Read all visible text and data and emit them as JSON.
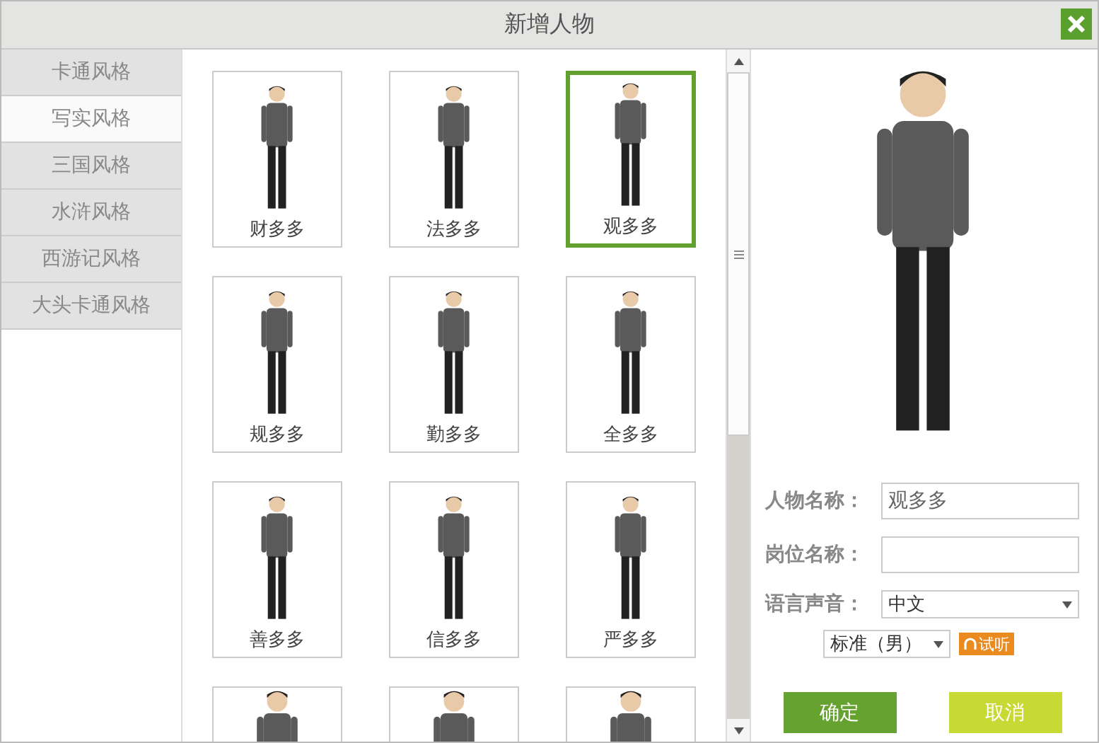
{
  "window": {
    "title": "新增人物"
  },
  "sidebar": {
    "items": [
      {
        "label": "卡通风格",
        "selected": false
      },
      {
        "label": "写实风格",
        "selected": true
      },
      {
        "label": "三国风格",
        "selected": false
      },
      {
        "label": "水浒风格",
        "selected": false
      },
      {
        "label": "西游记风格",
        "selected": false
      },
      {
        "label": "大头卡通风格",
        "selected": false
      }
    ]
  },
  "characters": [
    {
      "name": "财多多",
      "selected": false
    },
    {
      "name": "法多多",
      "selected": false
    },
    {
      "name": "观多多",
      "selected": true
    },
    {
      "name": "规多多",
      "selected": false
    },
    {
      "name": "勤多多",
      "selected": false
    },
    {
      "name": "全多多",
      "selected": false
    },
    {
      "name": "善多多",
      "selected": false
    },
    {
      "name": "信多多",
      "selected": false
    },
    {
      "name": "严多多",
      "selected": false
    },
    {
      "selected": false
    },
    {
      "selected": false
    },
    {
      "selected": false
    }
  ],
  "form": {
    "name_label": "人物名称：",
    "name_value": "观多多",
    "post_label": "岗位名称：",
    "voice_label": "语言声音：",
    "language": "中文",
    "voice": "标准（男）",
    "listen_button": "试听"
  },
  "buttons": {
    "confirm": "确定",
    "cancel": "取消"
  }
}
